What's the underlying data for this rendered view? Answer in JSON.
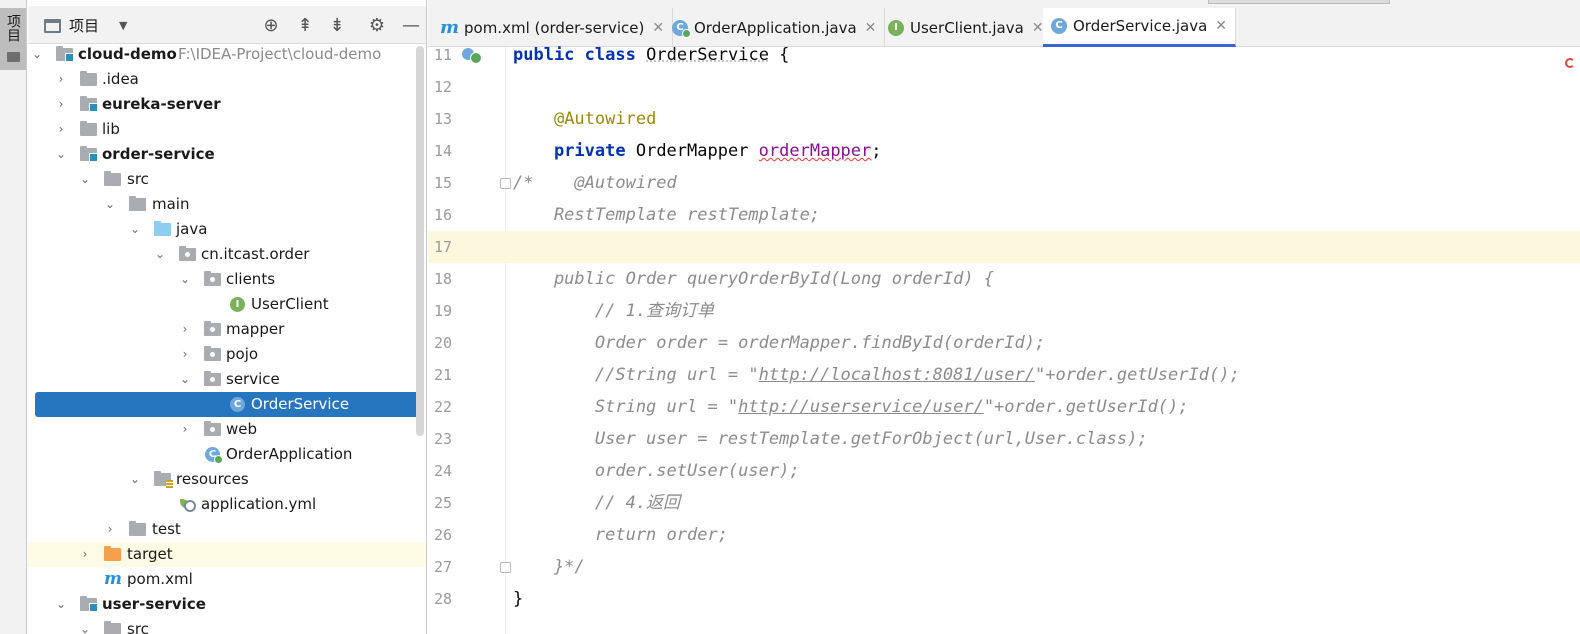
{
  "side_strip": {
    "label": "项目"
  },
  "panel": {
    "title": "项目",
    "tree": [
      {
        "label": "cloud-demo",
        "path": "F:\\IDEA-Project\\cloud-demo"
      },
      {
        "label": ".idea"
      },
      {
        "label": "eureka-server"
      },
      {
        "label": "lib"
      },
      {
        "label": "order-service"
      },
      {
        "label": "src"
      },
      {
        "label": "main"
      },
      {
        "label": "java"
      },
      {
        "label": "cn.itcast.order"
      },
      {
        "label": "clients"
      },
      {
        "label": "UserClient"
      },
      {
        "label": "mapper"
      },
      {
        "label": "pojo"
      },
      {
        "label": "service"
      },
      {
        "label": "OrderService"
      },
      {
        "label": "web"
      },
      {
        "label": "OrderApplication"
      },
      {
        "label": "resources"
      },
      {
        "label": "application.yml"
      },
      {
        "label": "test"
      },
      {
        "label": "target"
      },
      {
        "label": "pom.xml"
      },
      {
        "label": "user-service"
      },
      {
        "label": "src"
      }
    ]
  },
  "tabs": [
    {
      "label": "pom.xml (order-service)"
    },
    {
      "label": "OrderApplication.java"
    },
    {
      "label": "UserClient.java"
    },
    {
      "label": "OrderService.java"
    }
  ],
  "editor": {
    "line_numbers": [
      "11",
      "12",
      "13",
      "14",
      "15",
      "16",
      "17",
      "18",
      "19",
      "20",
      "21",
      "22",
      "23",
      "24",
      "25",
      "26",
      "27",
      "28"
    ],
    "lines": {
      "l11_kw1": "public",
      "l11_kw2": "class",
      "l11_name": "OrderService",
      "l11_rest": " {",
      "l13_ann": "@Autowired",
      "l14_kw": "private",
      "l14_type": " OrderMapper ",
      "l14_field": "orderMapper",
      "l14_rest": ";",
      "l15": "/*    @Autowired",
      "l16": "    RestTemplate restTemplate;",
      "l18": "    public Order queryOrderById(Long orderId) {",
      "l19": "        // 1.查询订单",
      "l20": "        Order order = orderMapper.findById(orderId);",
      "l21_a": "        //String url = \"",
      "l21_url": "http://localhost:8081/user/",
      "l21_b": "\"+order.getUserId();",
      "l22_a": "        String url = \"",
      "l22_url": "http://userservice/user/",
      "l22_b": "\"+order.getUserId();",
      "l23": "        User user = restTemplate.getForObject(url,User.class);",
      "l24": "        order.setUser(user);",
      "l25": "        // 4.返回",
      "l26": "        return order;",
      "l27": "    }*/",
      "l28": "}"
    }
  },
  "colors": {
    "selection": "#2675bf",
    "keyword": "#0033b3",
    "annotation": "#9e880d",
    "comment": "#8c8c8c",
    "current_line": "#fcf8de",
    "active_tab_underline": "#3d62d6"
  }
}
